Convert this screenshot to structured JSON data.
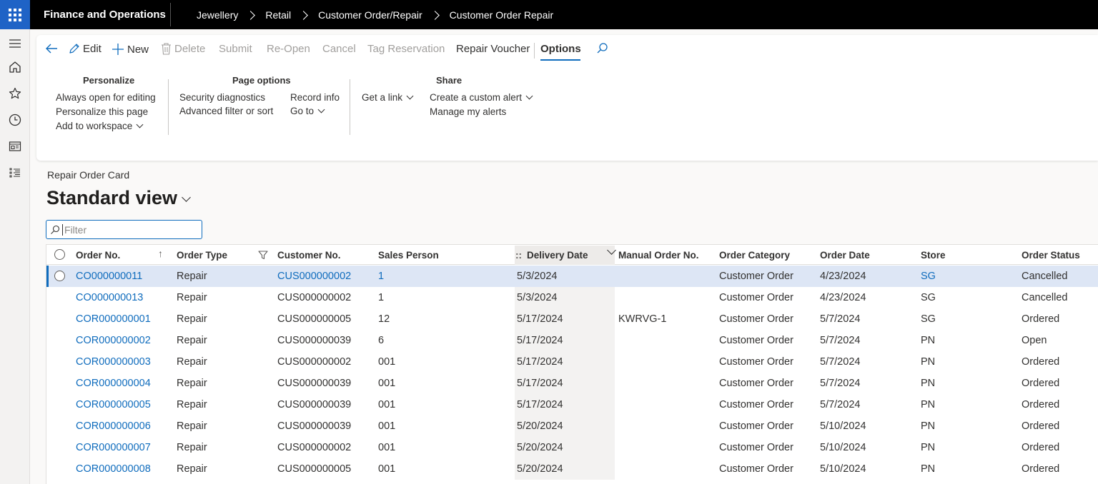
{
  "topbar": {
    "app_title": "Finance and Operations",
    "breadcrumbs": [
      "Jewellery",
      "Retail",
      "Customer Order/Repair",
      "Customer Order Repair"
    ]
  },
  "toolbar": {
    "edit": "Edit",
    "new": "New",
    "delete": "Delete",
    "submit": "Submit",
    "reopen": "Re-Open",
    "cancel": "Cancel",
    "tag_reservation": "Tag Reservation",
    "repair_voucher": "Repair Voucher",
    "options": "Options"
  },
  "options_menu": {
    "personalize": {
      "title": "Personalize",
      "items": [
        "Always open for editing",
        "Personalize this page",
        "Add to workspace"
      ]
    },
    "page_options": {
      "title": "Page options",
      "items": [
        "Security diagnostics",
        "Advanced filter or sort",
        "Record info",
        "Go to"
      ]
    },
    "share": {
      "title": "Share",
      "items": [
        "Get a link",
        "Create a custom alert",
        "Manage my alerts"
      ]
    }
  },
  "page": {
    "caption": "Repair Order Card",
    "view_name": "Standard view",
    "filter_placeholder": "Filter"
  },
  "grid": {
    "columns": [
      "Order No.",
      "Order Type",
      "Customer No.",
      "Sales Person",
      "Delivery Date",
      "Manual Order No.",
      "Order Category",
      "Order Date",
      "Store",
      "Order Status"
    ],
    "rows": [
      [
        "CO000000011",
        "Repair",
        "CUS000000002",
        "1",
        "5/3/2024",
        "",
        "Customer Order",
        "4/23/2024",
        "SG",
        "Cancelled"
      ],
      [
        "CO000000013",
        "Repair",
        "CUS000000002",
        "1",
        "5/3/2024",
        "",
        "Customer Order",
        "4/23/2024",
        "SG",
        "Cancelled"
      ],
      [
        "COR000000001",
        "Repair",
        "CUS000000005",
        "12",
        "5/17/2024",
        "KWRVG-1",
        "Customer Order",
        "5/7/2024",
        "SG",
        "Ordered"
      ],
      [
        "COR000000002",
        "Repair",
        "CUS000000039",
        "6",
        "5/17/2024",
        "",
        "Customer Order",
        "5/7/2024",
        "PN",
        "Open"
      ],
      [
        "COR000000003",
        "Repair",
        "CUS000000002",
        "001",
        "5/17/2024",
        "",
        "Customer Order",
        "5/7/2024",
        "PN",
        "Ordered"
      ],
      [
        "COR000000004",
        "Repair",
        "CUS000000039",
        "001",
        "5/17/2024",
        "",
        "Customer Order",
        "5/7/2024",
        "PN",
        "Ordered"
      ],
      [
        "COR000000005",
        "Repair",
        "CUS000000039",
        "001",
        "5/17/2024",
        "",
        "Customer Order",
        "5/7/2024",
        "PN",
        "Ordered"
      ],
      [
        "COR000000006",
        "Repair",
        "CUS000000039",
        "001",
        "5/20/2024",
        "",
        "Customer Order",
        "5/10/2024",
        "PN",
        "Ordered"
      ],
      [
        "COR000000007",
        "Repair",
        "CUS000000002",
        "001",
        "5/20/2024",
        "",
        "Customer Order",
        "5/10/2024",
        "PN",
        "Ordered"
      ],
      [
        "COR000000008",
        "Repair",
        "CUS000000005",
        "001",
        "5/20/2024",
        "",
        "Customer Order",
        "5/10/2024",
        "PN",
        "Ordered"
      ]
    ],
    "selected_row": 0
  },
  "colors": {
    "accent": "#0f6cbd",
    "waffle": "#1f63c6",
    "selected_row": "#dde6f5"
  }
}
